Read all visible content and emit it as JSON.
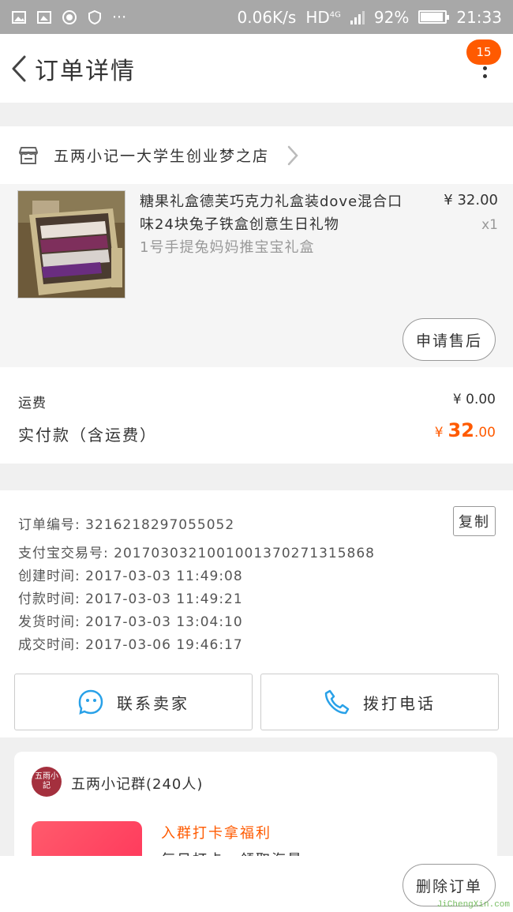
{
  "status_bar": {
    "speed": "0.06K/s",
    "network": "HD",
    "network_type": "4G",
    "battery_text": "92%",
    "battery_level": 0.92,
    "time": "21:33"
  },
  "header": {
    "title": "订单详情",
    "badge_count": "15"
  },
  "shop": {
    "name": "五两小记一大学生创业梦之店"
  },
  "item": {
    "title": "糖果礼盒德芙巧克力礼盒装dove混合口味24块兔子铁盒创意生日礼物",
    "spec": "1号手提兔妈妈推宝宝礼盒",
    "price": "¥ 32.00",
    "qty": "x1",
    "aftersale_label": "申请售后"
  },
  "fees": {
    "shipping_label": "运费",
    "shipping_value": "¥ 0.00",
    "paid_label": "实付款（含运费）",
    "paid_currency": "¥",
    "paid_int": "32",
    "paid_dec": ".00"
  },
  "order_info": {
    "order_no": "订单编号: 3216218297055052",
    "alipay_no": "支付宝交易号: 2017030321001001370271315868",
    "created": "创建时间: 2017-03-03 11:49:08",
    "paid": "付款时间: 2017-03-03 11:49:21",
    "shipped": "发货时间: 2017-03-03 13:04:10",
    "completed": "成交时间: 2017-03-06 19:46:17",
    "copy_label": "复制"
  },
  "actions": {
    "contact_label": "联系卖家",
    "call_label": "拨打电话"
  },
  "group": {
    "avatar_text": "五雨小記",
    "name": "五两小记群(240人)",
    "promo_title": "入群打卡拿福利",
    "promo_sub": "每日打卡，领取海量..."
  },
  "bottom": {
    "delete_label": "删除订单"
  },
  "watermark": "JiChengXin.com",
  "colors": {
    "accent": "#ff5a00",
    "status_bg": "#a8a8a8",
    "icon_blue": "#29a1e8"
  }
}
